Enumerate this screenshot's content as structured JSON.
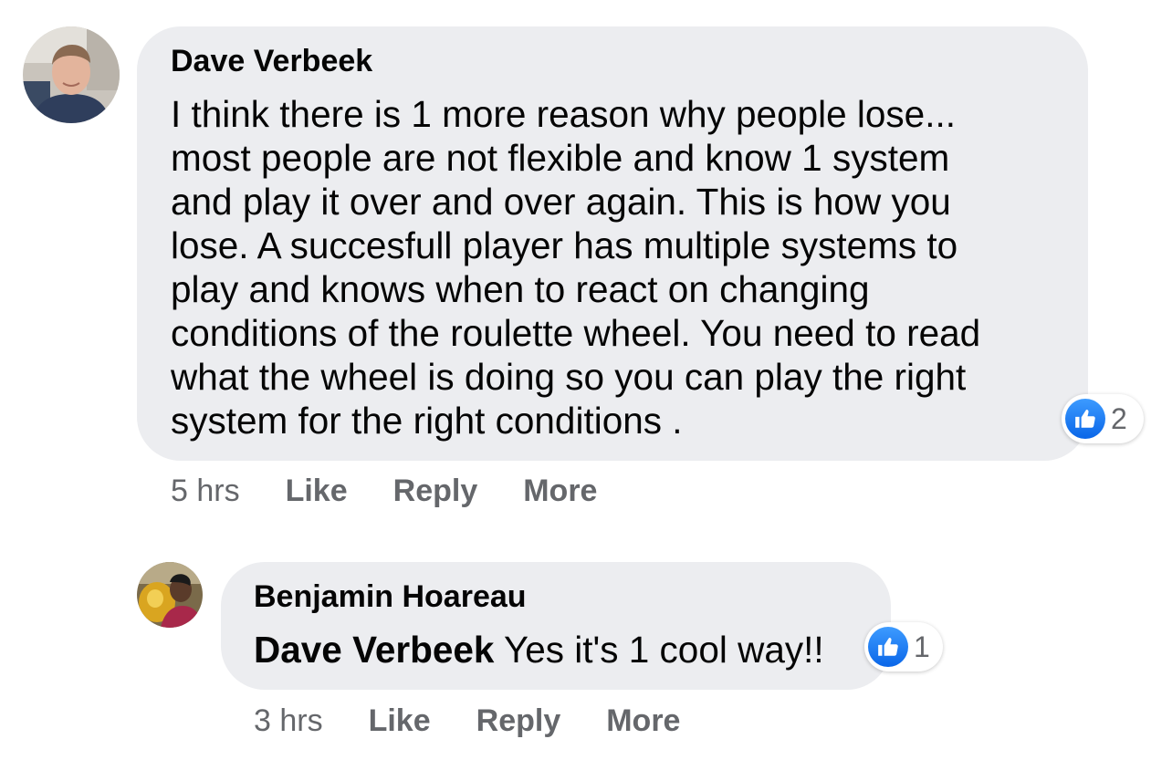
{
  "comments": [
    {
      "author": "Dave Verbeek",
      "text_lines": [
        "I think there is 1 more reason why people lose...",
        "most people are not flexible and know 1 system",
        "and play it over and over again. This is how you",
        "lose. A succesfull player has multiple systems to",
        "play and knows when to react on changing",
        "conditions of the roulette wheel. You need to read",
        "what the wheel is doing so you can play the right",
        "system for the right conditions ."
      ],
      "reaction_icon": "thumbs-up-icon",
      "reaction_count": "2",
      "timestamp": "5 hrs",
      "like_label": "Like",
      "reply_label": "Reply",
      "more_label": "More"
    },
    {
      "author": "Benjamin Hoareau",
      "mention": "Dave Verbeek",
      "text": " Yes it's 1 cool way!!",
      "reaction_icon": "thumbs-up-icon",
      "reaction_count": "1",
      "timestamp": "3 hrs",
      "like_label": "Like",
      "reply_label": "Reply",
      "more_label": "More"
    }
  ],
  "colors": {
    "bubble": "#ecedf0",
    "meta_text": "#65676b",
    "like_blue": "#1877f2"
  }
}
